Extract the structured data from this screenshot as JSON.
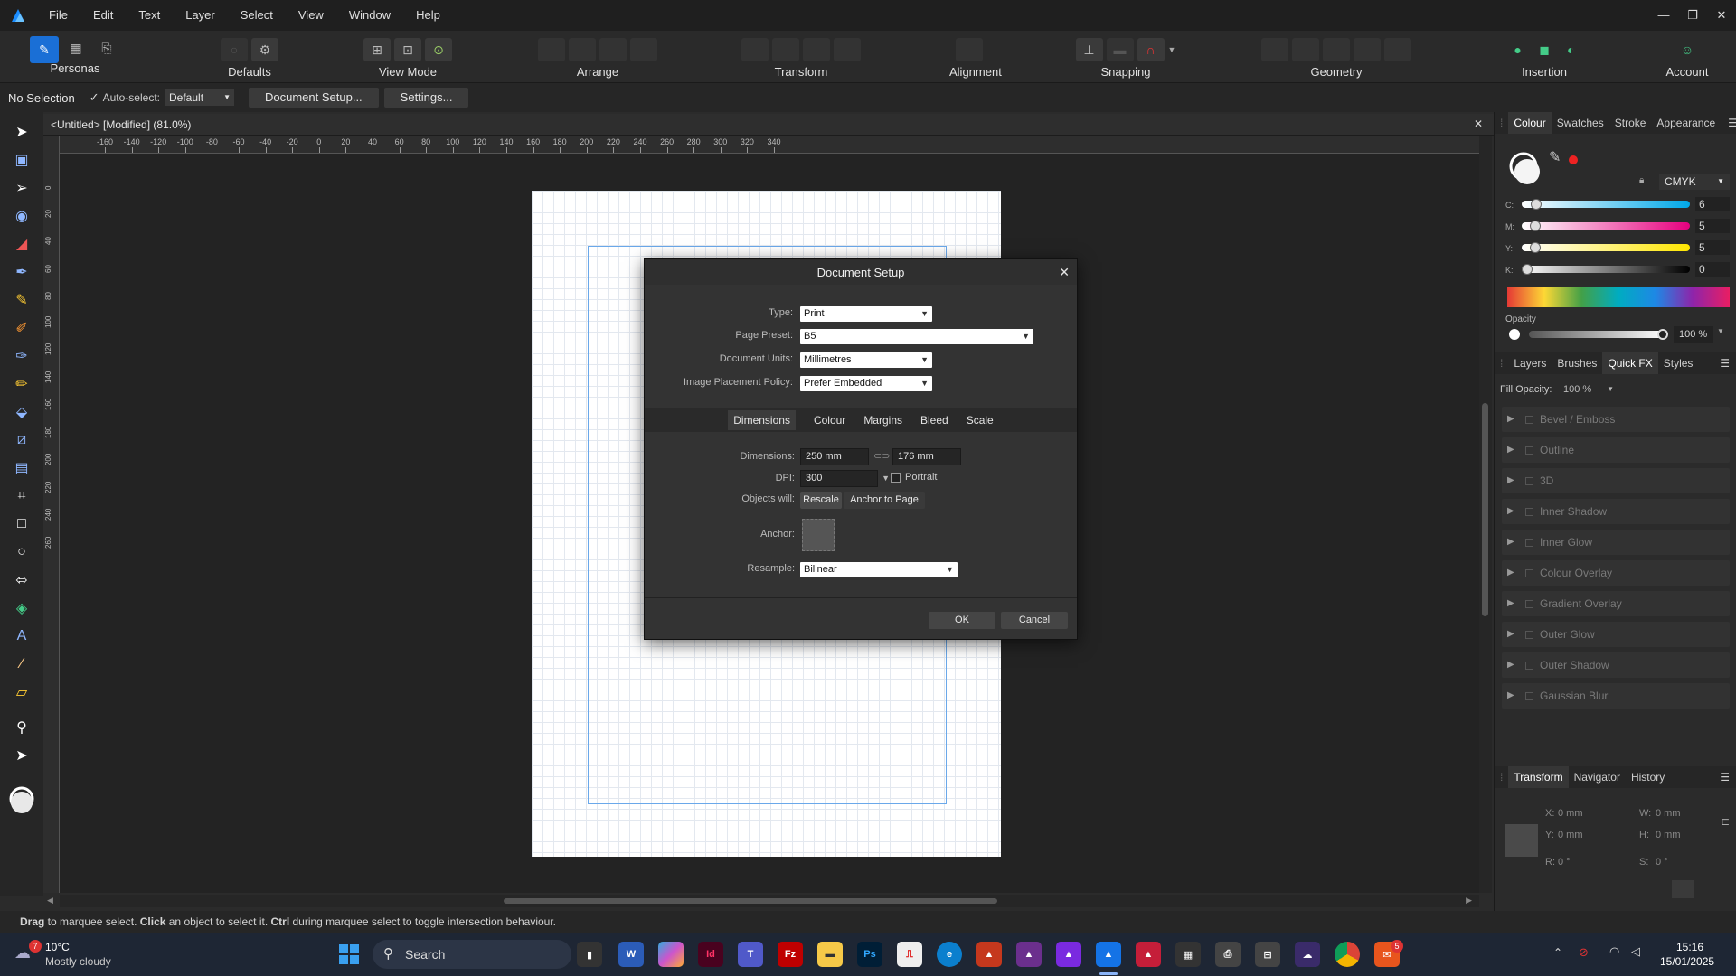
{
  "menu": [
    "File",
    "Edit",
    "Text",
    "Layer",
    "Select",
    "View",
    "Window",
    "Help"
  ],
  "window_controls": {
    "minimize": "—",
    "restore": "❐",
    "close": "✕"
  },
  "toolbar": {
    "personas": "Personas",
    "defaults": "Defaults",
    "view_mode": "View Mode",
    "arrange": "Arrange",
    "transform": "Transform",
    "alignment": "Alignment",
    "snapping": "Snapping",
    "geometry": "Geometry",
    "insertion": "Insertion",
    "account": "Account"
  },
  "context": {
    "selection": "No Selection",
    "auto_select": "Auto-select:",
    "auto_select_value": "Default",
    "doc_setup": "Document Setup...",
    "settings": "Settings..."
  },
  "document": {
    "tab_title": "<Untitled> [Modified] (81.0%)"
  },
  "ruler": {
    "h_ticks": [
      "-160",
      "-140",
      "-120",
      "-100",
      "-80",
      "-60",
      "-40",
      "-20",
      "0",
      "20",
      "40",
      "60",
      "80",
      "100",
      "120",
      "140",
      "160",
      "180",
      "200",
      "220",
      "240",
      "260",
      "280",
      "300",
      "320",
      "340"
    ],
    "v_ticks": [
      "0",
      "20",
      "40",
      "60",
      "80",
      "100",
      "120",
      "140",
      "160",
      "180",
      "200",
      "220",
      "240",
      "260"
    ],
    "unit": "mm"
  },
  "dialog": {
    "title": "Document Setup",
    "type_label": "Type:",
    "type_value": "Print",
    "preset_label": "Page Preset:",
    "preset_value": "B5",
    "units_label": "Document Units:",
    "units_value": "Millimetres",
    "placement_label": "Image Placement Policy:",
    "placement_value": "Prefer Embedded",
    "tabs": [
      "Dimensions",
      "Colour",
      "Margins",
      "Bleed",
      "Scale"
    ],
    "dimensions_label": "Dimensions:",
    "width": "250 mm",
    "height": "176 mm",
    "dpi_label": "DPI:",
    "dpi": "300",
    "portrait": "Portrait",
    "objects_label": "Objects will:",
    "rescale": "Rescale",
    "anchor_to_page": "Anchor to Page",
    "anchor_label": "Anchor:",
    "resample_label": "Resample:",
    "resample_value": "Bilinear",
    "ok": "OK",
    "cancel": "Cancel"
  },
  "status": {
    "drag": "Drag",
    "t1": " to marquee select. ",
    "click": "Click",
    "t2": " an object to select it. ",
    "ctrl": "Ctrl",
    "t3": " during marquee select to toggle intersection behaviour."
  },
  "colour_panel": {
    "tabs": [
      "Colour",
      "Swatches",
      "Stroke",
      "Appearance"
    ],
    "model": "CMYK",
    "c_label": "C:",
    "c": "6",
    "m_label": "M:",
    "m": "5",
    "y_label": "Y:",
    "y": "5",
    "k_label": "K:",
    "k": "0",
    "opacity_label": "Opacity",
    "opacity": "100 %"
  },
  "fx_panel": {
    "tabs": [
      "Layers",
      "Brushes",
      "Quick FX",
      "Styles"
    ],
    "fill_opacity_label": "Fill Opacity:",
    "fill_opacity": "100 %",
    "effects": [
      "Bevel / Emboss",
      "Outline",
      "3D",
      "Inner Shadow",
      "Inner Glow",
      "Colour Overlay",
      "Gradient Overlay",
      "Outer Glow",
      "Outer Shadow",
      "Gaussian Blur"
    ]
  },
  "transform_panel": {
    "tabs": [
      "Transform",
      "Navigator",
      "History"
    ],
    "x_label": "X:",
    "x": "0 mm",
    "w_label": "W:",
    "w": "0 mm",
    "y_label": "Y:",
    "y": "0 mm",
    "h_label": "H:",
    "h": "0 mm",
    "r_label": "R:",
    "r": "0 °",
    "s_label": "S:",
    "s": "0 °"
  },
  "taskbar": {
    "weather_temp": "10°C",
    "weather_desc": "Mostly cloudy",
    "weather_badge": "7",
    "search": "Search",
    "time": "15:16",
    "date": "15/01/2025",
    "notif_badge": "5",
    "apps": [
      "Id",
      "Ps",
      "Fz"
    ]
  },
  "colors": {
    "accent": "#4aa3ff",
    "page": "#ffffff",
    "canvas": "#232323",
    "panel": "#2b2b2b"
  }
}
